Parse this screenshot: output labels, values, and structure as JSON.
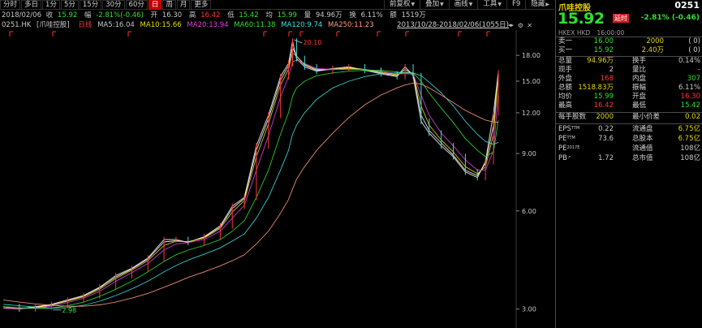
{
  "toolbar": {
    "tabs": [
      "分时",
      "多日",
      "1分",
      "5分",
      "15分",
      "30分",
      "60分",
      "日",
      "周",
      "月",
      "更多"
    ],
    "active_tab": "日",
    "tools": [
      "前复权",
      "叠加",
      "画线",
      "工具",
      "F9",
      "隐藏"
    ]
  },
  "quote": {
    "date": "2018/02/06",
    "receive_label": "收",
    "receive_value": "15.92",
    "change_label": "幅",
    "change_value": "-2.81%(-0.46)",
    "open_label": "开",
    "open_value": "16.30",
    "high_label": "高",
    "high_value": "16.42",
    "low_label": "低",
    "low_value": "15.42",
    "avg_label": "均",
    "avg_value": "15.99",
    "volume_label": "量",
    "volume_value": "94.96万",
    "turnover_label": "换",
    "turnover_value": "6.11%",
    "amount_label": "额",
    "amount_value": "1519万"
  },
  "ma": {
    "symbol": "0251.HK",
    "name_label": "[爪哇控股]",
    "adj_label": "日线",
    "ma5": "MA5:16.04",
    "ma10": "MA10:15.66",
    "ma20": "MA20:13.94",
    "ma60": "MA60:11.38",
    "ma120": "MA120:9.74",
    "ma250": "MA250:11.23",
    "range": "2013/10/28-2018/02/06(1055日)",
    "range_arrows": "◂▸",
    "gear_glyph": "⚙",
    "close_glyph": "✕"
  },
  "chart_data": {
    "type": "line",
    "title": "",
    "xlabel": "",
    "ylabel": "",
    "y_ticks": [
      "18.00",
      "15.00",
      "12.00",
      "9.00",
      "6.00",
      "3.00"
    ],
    "ylim": [
      2.7,
      20.8
    ],
    "log_scale": true,
    "x": [
      0,
      20,
      40,
      60,
      80,
      100,
      120,
      140,
      160,
      180,
      200,
      215,
      230,
      250,
      270,
      285,
      300,
      315,
      330,
      345,
      355,
      360,
      365,
      375,
      390,
      410,
      430,
      450,
      470,
      490,
      500,
      510,
      520,
      530,
      545,
      560,
      575,
      590,
      600,
      610,
      616
    ],
    "series": [
      {
        "name": "price",
        "color": "#d0d0d0",
        "values": [
          3.05,
          3.0,
          3.05,
          3.1,
          3.2,
          3.3,
          3.5,
          3.8,
          4.0,
          4.3,
          4.9,
          4.9,
          4.8,
          5.0,
          5.4,
          6.2,
          6.6,
          9.5,
          11.8,
          15.5,
          17.0,
          19.9,
          17.6,
          16.6,
          16.1,
          16.4,
          16.6,
          16.2,
          15.8,
          15.5,
          16.6,
          15.6,
          11.3,
          10.4,
          9.5,
          8.8,
          7.9,
          7.6,
          8.5,
          12.0,
          15.9
        ]
      },
      {
        "name": "MA5",
        "color": "#ffffff",
        "values": [
          3.02,
          3.0,
          3.04,
          3.09,
          3.18,
          3.29,
          3.48,
          3.76,
          3.98,
          4.27,
          4.82,
          4.86,
          4.82,
          4.98,
          5.35,
          6.1,
          6.55,
          9.2,
          11.5,
          15.1,
          16.7,
          19.0,
          17.9,
          16.8,
          16.2,
          16.3,
          16.5,
          16.3,
          15.9,
          15.6,
          16.3,
          15.8,
          11.8,
          10.6,
          9.7,
          8.9,
          8.0,
          7.7,
          8.4,
          11.0,
          16.04
        ]
      },
      {
        "name": "MA10",
        "color": "#e6d800",
        "values": [
          3.02,
          3.0,
          3.03,
          3.08,
          3.17,
          3.27,
          3.45,
          3.72,
          3.95,
          4.22,
          4.7,
          4.84,
          4.83,
          4.95,
          5.3,
          5.95,
          6.45,
          8.8,
          11.1,
          14.6,
          16.3,
          18.3,
          17.9,
          16.9,
          16.3,
          16.3,
          16.4,
          16.3,
          16.0,
          15.7,
          16.0,
          15.9,
          12.6,
          11.0,
          9.9,
          9.1,
          8.2,
          7.8,
          8.2,
          10.3,
          15.66
        ]
      },
      {
        "name": "MA20",
        "color": "#e040e0",
        "values": [
          3.02,
          3.01,
          3.02,
          3.06,
          3.14,
          3.24,
          3.4,
          3.65,
          3.88,
          4.14,
          4.55,
          4.75,
          4.8,
          4.9,
          5.2,
          5.7,
          6.25,
          8.0,
          10.2,
          13.4,
          15.5,
          17.2,
          17.4,
          17.0,
          16.4,
          16.3,
          16.3,
          16.3,
          16.1,
          15.8,
          15.8,
          15.8,
          13.6,
          11.8,
          10.4,
          9.5,
          8.6,
          8.0,
          8.0,
          9.2,
          13.94
        ]
      },
      {
        "name": "MA60",
        "color": "#2fe02f",
        "values": [
          3.05,
          3.03,
          3.01,
          3.02,
          3.07,
          3.15,
          3.28,
          3.45,
          3.65,
          3.9,
          4.2,
          4.4,
          4.55,
          4.7,
          4.9,
          5.2,
          5.6,
          6.6,
          8.0,
          10.3,
          12.0,
          13.5,
          14.3,
          15.0,
          15.6,
          15.9,
          16.1,
          16.2,
          16.2,
          16.0,
          15.9,
          15.9,
          15.0,
          13.8,
          12.4,
          11.2,
          10.0,
          9.2,
          8.8,
          9.1,
          11.38
        ]
      },
      {
        "name": "MA120",
        "color": "#3ce0e0",
        "values": [
          3.1,
          3.07,
          3.04,
          3.02,
          3.03,
          3.08,
          3.17,
          3.3,
          3.46,
          3.65,
          3.9,
          4.08,
          4.24,
          4.42,
          4.62,
          4.85,
          5.1,
          5.7,
          6.6,
          8.0,
          9.2,
          10.3,
          11.0,
          12.0,
          13.2,
          14.3,
          15.0,
          15.5,
          15.8,
          15.9,
          15.9,
          15.9,
          15.6,
          14.9,
          13.8,
          12.6,
          11.3,
          10.3,
          9.8,
          9.6,
          9.74
        ]
      },
      {
        "name": "MA250",
        "color": "#ff9a7a",
        "values": [
          3.2,
          3.15,
          3.11,
          3.08,
          3.06,
          3.06,
          3.09,
          3.15,
          3.24,
          3.35,
          3.5,
          3.62,
          3.75,
          3.9,
          4.07,
          4.22,
          4.4,
          4.75,
          5.2,
          5.9,
          6.5,
          7.0,
          7.5,
          8.2,
          9.2,
          10.4,
          11.6,
          12.7,
          13.6,
          14.3,
          14.6,
          14.8,
          14.7,
          14.3,
          13.6,
          12.9,
          12.2,
          11.7,
          11.4,
          11.25,
          11.23
        ]
      }
    ],
    "annotations": [
      {
        "x": 362,
        "y": 20.1,
        "text": "20.10"
      },
      {
        "x": 62,
        "y": 2.98,
        "text": "2.98"
      }
    ]
  },
  "panel": {
    "name": "爪哇控股",
    "code": "0251",
    "price": "15.92",
    "delay_badge": "延时",
    "change": "-2.81% (-0.46)",
    "market": "HKEX HKD",
    "time": "16:00:00",
    "ask_label": "卖一",
    "ask_price": "16.00",
    "ask_qty": "2000",
    "ask_paren": "( 0)",
    "bid_label": "买一",
    "bid_price": "15.92",
    "bid_qty": "2.40万",
    "bid_paren": "( 0)",
    "rows1": [
      {
        "l1": "总量",
        "v1": "94.96万",
        "l2": "换手",
        "v3": "0.14%"
      },
      {
        "l1": "现手",
        "v1": "2",
        "l2": "量比",
        "v3": "-"
      },
      {
        "l1": "外盘",
        "v1": "168",
        "l2": "内盘",
        "v3": "307"
      },
      {
        "l1": "总额",
        "v1": "1518.83万",
        "l2": "振幅",
        "v3": "6.11%"
      },
      {
        "l1": "均价",
        "v1": "15.99",
        "l2": "开盘",
        "v3": "16.30"
      },
      {
        "l1": "最高",
        "v1": "16.42",
        "l2": "最低",
        "v3": "15.42"
      }
    ],
    "lot_label": "每手股数",
    "lot_value": "2000",
    "tick_label": "最小价差",
    "tick_value": "0.02",
    "rows2": [
      {
        "l1": "EPS",
        "sup": "TTM",
        "v1": "0.22",
        "l2": "流通盘",
        "v3": "6.75亿"
      },
      {
        "l1": "PE",
        "sup": "TTM",
        "v1": "73.6",
        "l2": "总股本",
        "v3": "6.75亿"
      },
      {
        "l1": "PE",
        "sup": "2017E",
        "v1": "",
        "l2": "流通值",
        "v3": "108亿"
      },
      {
        "l1": "PB",
        "sup": "↗",
        "v1": "1.72",
        "l2": "总市值",
        "v3": "108亿"
      }
    ]
  }
}
